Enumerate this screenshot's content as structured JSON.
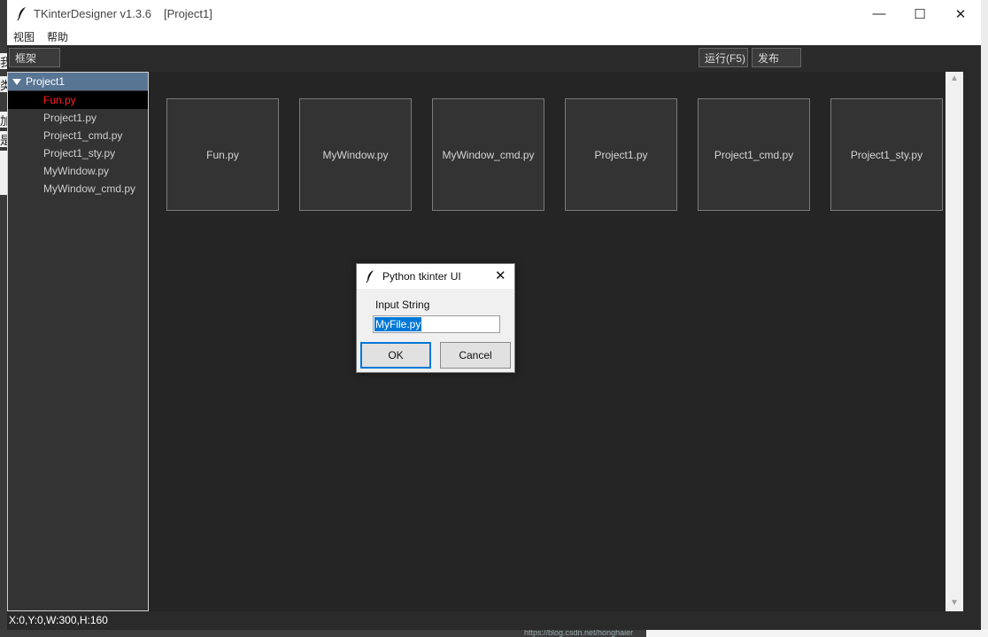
{
  "window": {
    "app_name": "TKinterDesigner v1.3.6",
    "project_tag": "[Project1]",
    "minimize": "—",
    "maximize": "☐",
    "close": "✕"
  },
  "menu": {
    "items": [
      "视图",
      "帮助"
    ]
  },
  "toolbar": {
    "frame_button": "框架",
    "run_button": "运行(F5)",
    "publish_button": "发布"
  },
  "tree": {
    "root": "Project1",
    "items": [
      {
        "label": "Fun.py",
        "selected": true
      },
      {
        "label": "Project1.py",
        "selected": false
      },
      {
        "label": "Project1_cmd.py",
        "selected": false
      },
      {
        "label": "Project1_sty.py",
        "selected": false
      },
      {
        "label": "MyWindow.py",
        "selected": false
      },
      {
        "label": "MyWindow_cmd.py",
        "selected": false
      }
    ]
  },
  "files": [
    "Fun.py",
    "MyWindow.py",
    "MyWindow_cmd.py",
    "Project1.py",
    "Project1_cmd.py",
    "Project1_sty.py"
  ],
  "status": {
    "text": "X:0,Y:0,W:300,H:160"
  },
  "dialog": {
    "title": "Python tkinter UI",
    "close": "✕",
    "label": "Input String",
    "input_value": "MyFile.py",
    "ok_label": "OK",
    "cancel_label": "Cancel"
  },
  "background": {
    "left_fragments": [
      "我",
      "类",
      "加",
      "是"
    ],
    "url_text": "https://blog.csdn.net/honghaier"
  },
  "colors": {
    "tree_root_bg": "#587594",
    "selected_text": "#ff2020",
    "selection_highlight": "#0078d7"
  },
  "scroll": {
    "up": "▲",
    "down": "▼"
  }
}
